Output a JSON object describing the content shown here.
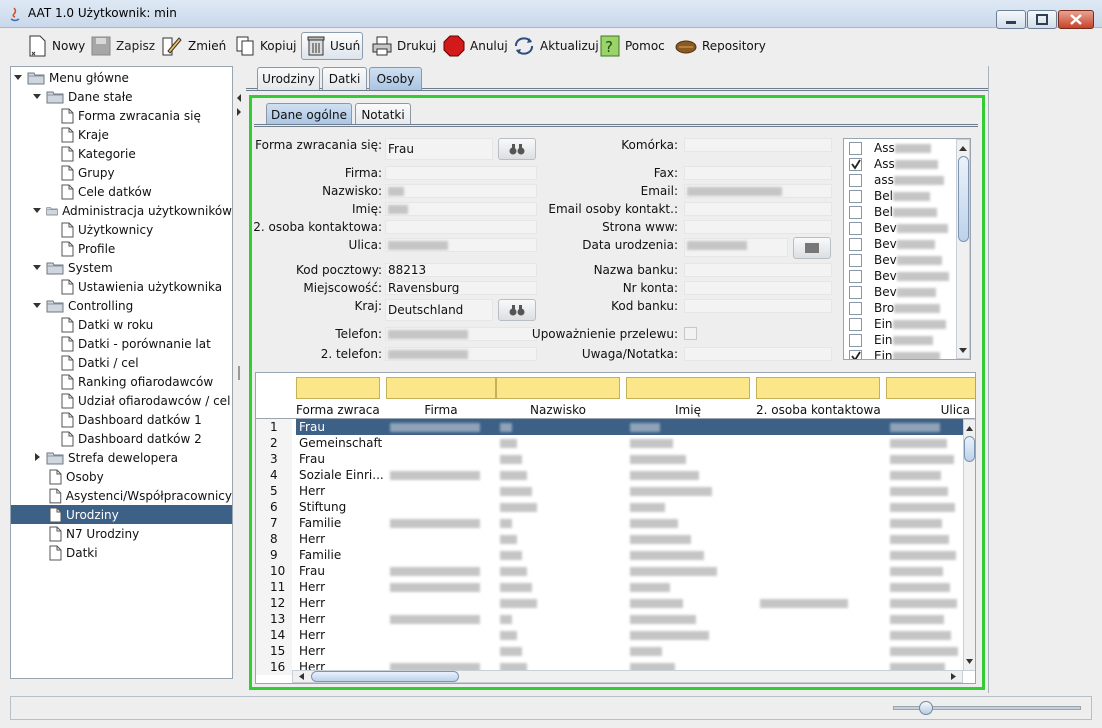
{
  "window": {
    "title": "AAT 1.0  Użytkownik: min"
  },
  "toolbar": {
    "new": "Nowy",
    "save": "Zapisz",
    "edit": "Zmień",
    "copy": "Kopiuj",
    "delete": "Usuń",
    "print": "Drukuj",
    "cancel": "Anuluj",
    "refresh": "Aktualizuj",
    "help": "Pomoc",
    "repository": "Repository"
  },
  "tree": {
    "root": "Menu główne",
    "dane": "Dane stałe",
    "forma": "Forma zwracania się",
    "kraje": "Kraje",
    "kategorie": "Kategorie",
    "grupy": "Grupy",
    "cele": "Cele datków",
    "admin": "Administracja użytkowników",
    "uzytkownicy": "Użytkownicy",
    "profile": "Profile",
    "system": "System",
    "ustawienia": "Ustawienia użytkownika",
    "controlling": "Controlling",
    "datki_roku": "Datki w roku",
    "datki_por": "Datki - porównanie lat",
    "datki_cel": "Datki / cel",
    "ranking": "Ranking ofiarodawców",
    "udzial": "Udział ofiarodawców / cel",
    "dash1": "Dashboard datków 1",
    "dash2": "Dashboard datków 2",
    "strefa": "Strefa dewelopera",
    "osoby": "Osoby",
    "asystenci": "Asystenci/Współpracownicy",
    "urodziny": "Urodziny",
    "n7": "N7 Urodziny",
    "datki": "Datki"
  },
  "tabs": {
    "urodziny": "Urodziny",
    "datki": "Datki",
    "osoby": "Osoby"
  },
  "subtabs": {
    "dane": "Dane ogólne",
    "notatki": "Notatki"
  },
  "form": {
    "forma_label": "Forma zwracania się:",
    "forma_value": "Frau",
    "firma_label": "Firma:",
    "nazwisko_label": "Nazwisko:",
    "imie_label": "Imię:",
    "osoba2_label": "2. osoba kontaktowa:",
    "ulica_label": "Ulica:",
    "kod_label": "Kod pocztowy:",
    "kod_value": "88213",
    "miejsc_label": "Miejscowość:",
    "miejsc_value": "Ravensburg",
    "kraj_label": "Kraj:",
    "kraj_value": "Deutschland",
    "telefon_label": "Telefon:",
    "telefon2_label": "2. telefon:",
    "komorka_label": "Komórka:",
    "fax_label": "Fax:",
    "email_label": "Email:",
    "email_kont_label": "Email osoby kontakt.:",
    "www_label": "Strona www:",
    "urodz_label": "Data urodzenia:",
    "bank_label": "Nazwa banku:",
    "konto_label": "Nr konta:",
    "kodbank_label": "Kod banku:",
    "upow_label": "Upoważnienie przelewu:",
    "uwaga_label": "Uwaga/Notatka:"
  },
  "checklist": [
    {
      "text": "Ass",
      "checked": false
    },
    {
      "text": "Ass",
      "checked": true
    },
    {
      "text": "ass",
      "checked": false
    },
    {
      "text": "Bel",
      "checked": false
    },
    {
      "text": "Bel",
      "checked": false
    },
    {
      "text": "Bev",
      "checked": false
    },
    {
      "text": "Bev",
      "checked": false
    },
    {
      "text": "Bev",
      "checked": false
    },
    {
      "text": "Bev",
      "checked": false
    },
    {
      "text": "Bev",
      "checked": false
    },
    {
      "text": "Bro",
      "checked": false
    },
    {
      "text": "Ein",
      "checked": false
    },
    {
      "text": "Ein",
      "checked": false
    },
    {
      "text": "Ein",
      "checked": true
    }
  ],
  "grid": {
    "columns": [
      "Forma zwraca...",
      "Firma",
      "Nazwisko",
      "Imię",
      "2. osoba kontaktowa",
      "Ulica"
    ],
    "rows": [
      {
        "n": "1",
        "forma": "Frau"
      },
      {
        "n": "2",
        "forma": "Gemeinschaft"
      },
      {
        "n": "3",
        "forma": "Frau"
      },
      {
        "n": "4",
        "forma": "Soziale Einri..."
      },
      {
        "n": "5",
        "forma": "Herr"
      },
      {
        "n": "6",
        "forma": "Stiftung"
      },
      {
        "n": "7",
        "forma": "Familie"
      },
      {
        "n": "8",
        "forma": "Herr"
      },
      {
        "n": "9",
        "forma": "Familie"
      },
      {
        "n": "10",
        "forma": "Frau"
      },
      {
        "n": "11",
        "forma": "Herr"
      },
      {
        "n": "12",
        "forma": "Herr"
      },
      {
        "n": "13",
        "forma": "Herr"
      },
      {
        "n": "14",
        "forma": "Herr"
      },
      {
        "n": "15",
        "forma": "Herr"
      },
      {
        "n": "16",
        "forma": "Herr"
      }
    ]
  },
  "colors": {
    "selection": "#3c6086",
    "highlight_border": "#33cc33",
    "filter_bg": "#fbe78a"
  }
}
